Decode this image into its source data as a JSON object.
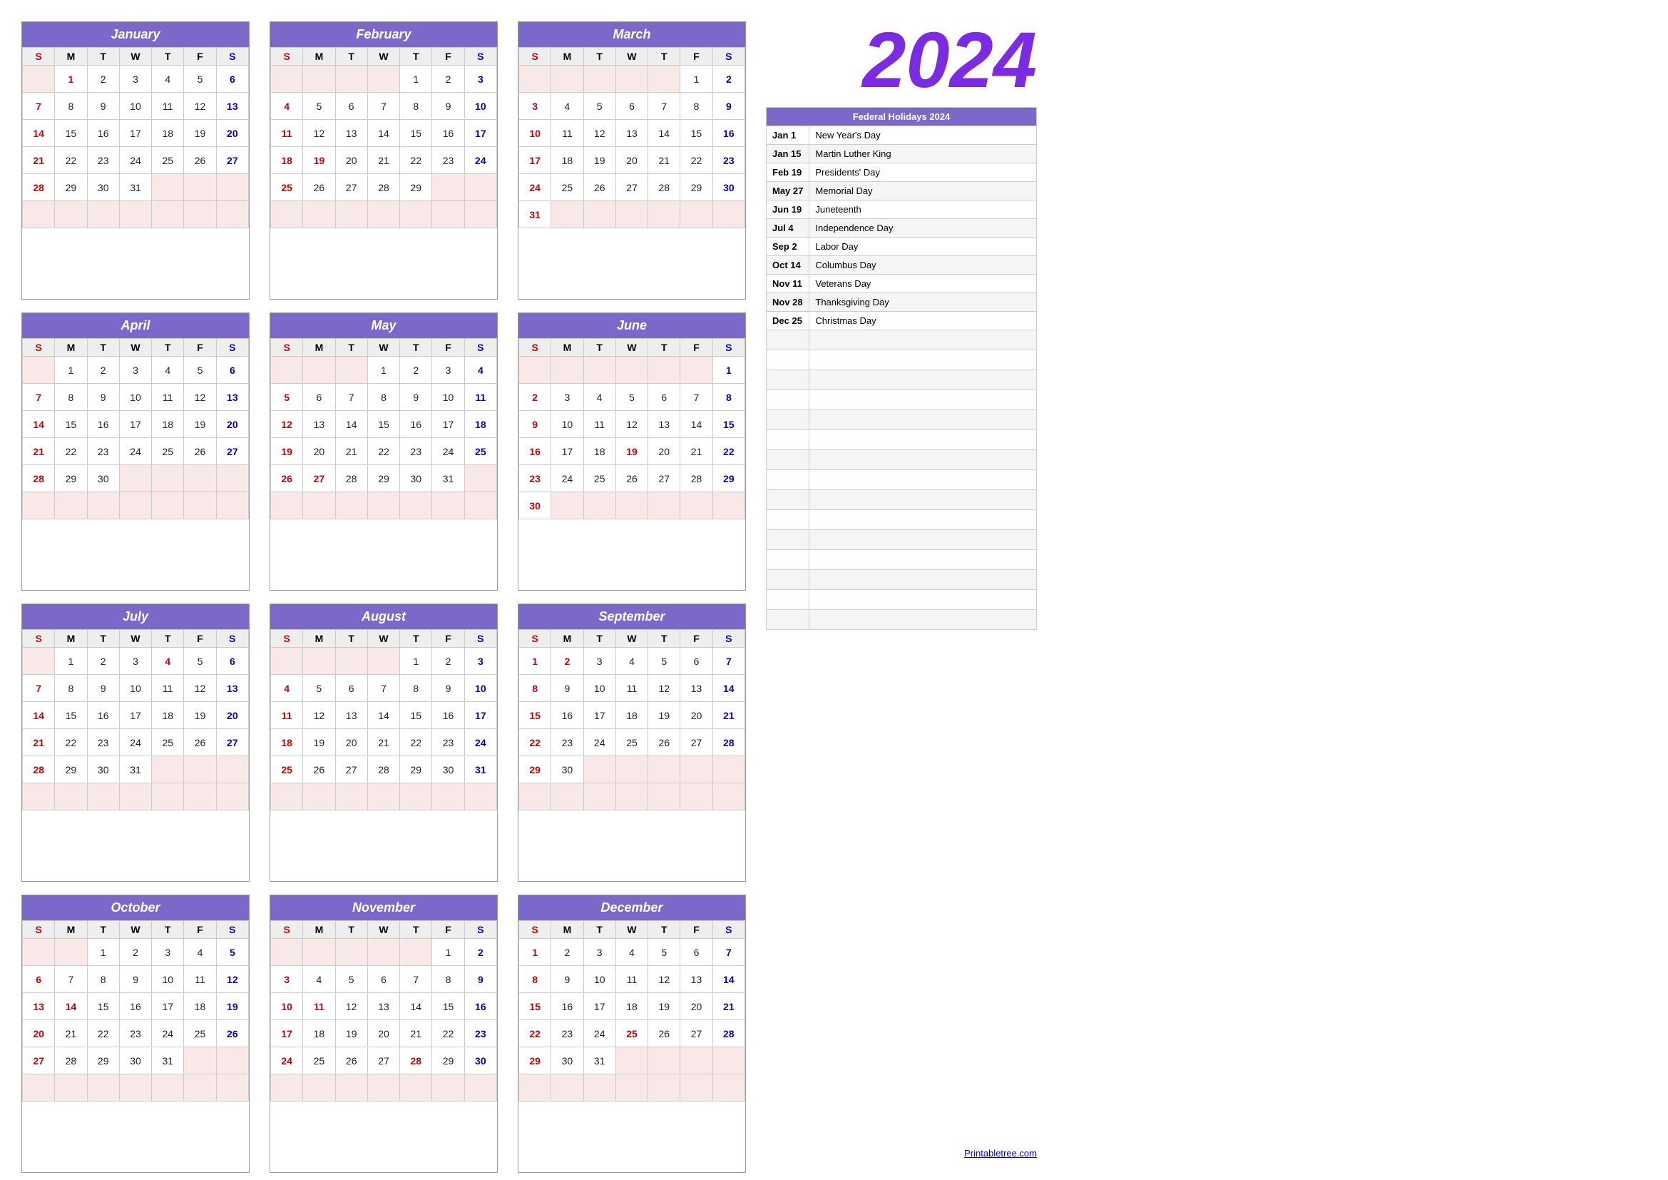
{
  "year": "2024",
  "months": [
    {
      "name": "January",
      "days": [
        [
          "",
          "1",
          "2",
          "3",
          "4",
          "5",
          "6"
        ],
        [
          "7",
          "8",
          "9",
          "10",
          "11",
          "12",
          "13"
        ],
        [
          "14",
          "15",
          "16",
          "17",
          "18",
          "19",
          "20"
        ],
        [
          "21",
          "22",
          "23",
          "24",
          "25",
          "26",
          "27"
        ],
        [
          "28",
          "29",
          "30",
          "31",
          "",
          "",
          ""
        ],
        [
          "",
          "",
          "",
          "",
          "",
          "",
          ""
        ]
      ],
      "holidays": [
        "1"
      ]
    },
    {
      "name": "February",
      "days": [
        [
          "",
          "",
          "",
          "",
          "1",
          "2",
          "3"
        ],
        [
          "4",
          "5",
          "6",
          "7",
          "8",
          "9",
          "10"
        ],
        [
          "11",
          "12",
          "13",
          "14",
          "15",
          "16",
          "17"
        ],
        [
          "18",
          "19",
          "20",
          "21",
          "22",
          "23",
          "24"
        ],
        [
          "25",
          "26",
          "27",
          "28",
          "29",
          "",
          ""
        ],
        [
          "",
          "",
          "",
          "",
          "",
          "",
          ""
        ]
      ],
      "holidays": [
        "19"
      ]
    },
    {
      "name": "March",
      "days": [
        [
          "",
          "",
          "",
          "",
          "",
          "1",
          "2"
        ],
        [
          "3",
          "4",
          "5",
          "6",
          "7",
          "8",
          "9"
        ],
        [
          "10",
          "11",
          "12",
          "13",
          "14",
          "15",
          "16"
        ],
        [
          "17",
          "18",
          "19",
          "20",
          "21",
          "22",
          "23"
        ],
        [
          "24",
          "25",
          "26",
          "27",
          "28",
          "29",
          "30"
        ],
        [
          "31",
          "",
          "",
          "",
          "",
          "",
          ""
        ]
      ],
      "holidays": []
    },
    {
      "name": "April",
      "days": [
        [
          "",
          "1",
          "2",
          "3",
          "4",
          "5",
          "6"
        ],
        [
          "7",
          "8",
          "9",
          "10",
          "11",
          "12",
          "13"
        ],
        [
          "14",
          "15",
          "16",
          "17",
          "18",
          "19",
          "20"
        ],
        [
          "21",
          "22",
          "23",
          "24",
          "25",
          "26",
          "27"
        ],
        [
          "28",
          "29",
          "30",
          "",
          "",
          "",
          ""
        ],
        [
          "",
          "",
          "",
          "",
          "",
          "",
          ""
        ]
      ],
      "holidays": []
    },
    {
      "name": "May",
      "days": [
        [
          "",
          "",
          "",
          "1",
          "2",
          "3",
          "4"
        ],
        [
          "5",
          "6",
          "7",
          "8",
          "9",
          "10",
          "11"
        ],
        [
          "12",
          "13",
          "14",
          "15",
          "16",
          "17",
          "18"
        ],
        [
          "19",
          "20",
          "21",
          "22",
          "23",
          "24",
          "25"
        ],
        [
          "26",
          "27",
          "28",
          "29",
          "30",
          "31",
          ""
        ],
        [
          "",
          "",
          "",
          "",
          "",
          "",
          ""
        ]
      ],
      "holidays": [
        "27"
      ]
    },
    {
      "name": "June",
      "days": [
        [
          "",
          "",
          "",
          "",
          "",
          "",
          "1"
        ],
        [
          "2",
          "3",
          "4",
          "5",
          "6",
          "7",
          "8"
        ],
        [
          "9",
          "10",
          "11",
          "12",
          "13",
          "14",
          "15"
        ],
        [
          "16",
          "17",
          "18",
          "19",
          "20",
          "21",
          "22"
        ],
        [
          "23",
          "24",
          "25",
          "26",
          "27",
          "28",
          "29"
        ],
        [
          "30",
          "",
          "",
          "",
          "",
          "",
          ""
        ]
      ],
      "holidays": [
        "19"
      ]
    },
    {
      "name": "July",
      "days": [
        [
          "",
          "1",
          "2",
          "3",
          "4",
          "5",
          "6"
        ],
        [
          "7",
          "8",
          "9",
          "10",
          "11",
          "12",
          "13"
        ],
        [
          "14",
          "15",
          "16",
          "17",
          "18",
          "19",
          "20"
        ],
        [
          "21",
          "22",
          "23",
          "24",
          "25",
          "26",
          "27"
        ],
        [
          "28",
          "29",
          "30",
          "31",
          "",
          "",
          ""
        ],
        [
          "",
          "",
          "",
          "",
          "",
          "",
          ""
        ]
      ],
      "holidays": [
        "4"
      ]
    },
    {
      "name": "August",
      "days": [
        [
          "",
          "",
          "",
          "",
          "1",
          "2",
          "3"
        ],
        [
          "4",
          "5",
          "6",
          "7",
          "8",
          "9",
          "10"
        ],
        [
          "11",
          "12",
          "13",
          "14",
          "15",
          "16",
          "17"
        ],
        [
          "18",
          "19",
          "20",
          "21",
          "22",
          "23",
          "24"
        ],
        [
          "25",
          "26",
          "27",
          "28",
          "29",
          "30",
          "31"
        ],
        [
          "",
          "",
          "",
          "",
          "",
          "",
          ""
        ]
      ],
      "holidays": []
    },
    {
      "name": "September",
      "days": [
        [
          "1",
          "2",
          "3",
          "4",
          "5",
          "6",
          "7"
        ],
        [
          "8",
          "9",
          "10",
          "11",
          "12",
          "13",
          "14"
        ],
        [
          "15",
          "16",
          "17",
          "18",
          "19",
          "20",
          "21"
        ],
        [
          "22",
          "23",
          "24",
          "25",
          "26",
          "27",
          "28"
        ],
        [
          "29",
          "30",
          "",
          "",
          "",
          "",
          ""
        ],
        [
          "",
          "",
          "",
          "",
          "",
          "",
          ""
        ]
      ],
      "holidays": [
        "2"
      ]
    },
    {
      "name": "October",
      "days": [
        [
          "",
          "",
          "1",
          "2",
          "3",
          "4",
          "5"
        ],
        [
          "6",
          "7",
          "8",
          "9",
          "10",
          "11",
          "12"
        ],
        [
          "13",
          "14",
          "15",
          "16",
          "17",
          "18",
          "19"
        ],
        [
          "20",
          "21",
          "22",
          "23",
          "24",
          "25",
          "26"
        ],
        [
          "27",
          "28",
          "29",
          "30",
          "31",
          "",
          ""
        ],
        [
          "",
          "",
          "",
          "",
          "",
          "",
          ""
        ]
      ],
      "holidays": [
        "14"
      ]
    },
    {
      "name": "November",
      "days": [
        [
          "",
          "",
          "",
          "",
          "",
          "1",
          "2"
        ],
        [
          "3",
          "4",
          "5",
          "6",
          "7",
          "8",
          "9"
        ],
        [
          "10",
          "11",
          "12",
          "13",
          "14",
          "15",
          "16"
        ],
        [
          "17",
          "18",
          "19",
          "20",
          "21",
          "22",
          "23"
        ],
        [
          "24",
          "25",
          "26",
          "27",
          "28",
          "29",
          "30"
        ],
        [
          "",
          "",
          "",
          "",
          "",
          "",
          ""
        ]
      ],
      "holidays": [
        "11",
        "28"
      ]
    },
    {
      "name": "December",
      "days": [
        [
          "1",
          "2",
          "3",
          "4",
          "5",
          "6",
          "7"
        ],
        [
          "8",
          "9",
          "10",
          "11",
          "12",
          "13",
          "14"
        ],
        [
          "15",
          "16",
          "17",
          "18",
          "19",
          "20",
          "21"
        ],
        [
          "22",
          "23",
          "24",
          "25",
          "26",
          "27",
          "28"
        ],
        [
          "29",
          "30",
          "31",
          "",
          "",
          "",
          ""
        ],
        [
          "",
          "",
          "",
          "",
          "",
          "",
          ""
        ]
      ],
      "holidays": [
        "25"
      ]
    }
  ],
  "dayHeaders": [
    "S",
    "M",
    "T",
    "W",
    "T",
    "F",
    "S"
  ],
  "holidays_panel": {
    "header": "Federal Holidays 2024",
    "items": [
      {
        "date": "Jan 1",
        "name": "New Year's Day"
      },
      {
        "date": "Jan 15",
        "name": "Martin Luther King"
      },
      {
        "date": "Feb 19",
        "name": "Presidents' Day"
      },
      {
        "date": "May 27",
        "name": "Memorial Day"
      },
      {
        "date": "Jun 19",
        "name": "Juneteenth"
      },
      {
        "date": "Jul 4",
        "name": "Independence Day"
      },
      {
        "date": "Sep 2",
        "name": "Labor Day"
      },
      {
        "date": "Oct 14",
        "name": "Columbus Day"
      },
      {
        "date": "Nov 11",
        "name": "Veterans Day"
      },
      {
        "date": "Nov 28",
        "name": "Thanksgiving Day"
      },
      {
        "date": "Dec 25",
        "name": "Christmas Day"
      }
    ]
  },
  "footer_link": "Printabletree.com"
}
